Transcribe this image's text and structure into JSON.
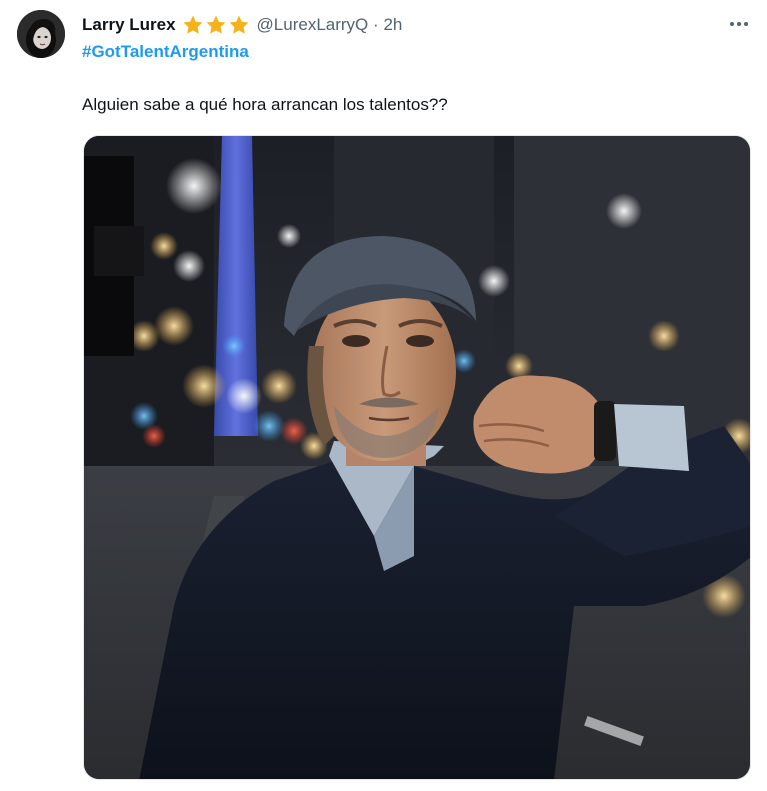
{
  "user": {
    "display_name": "Larry Lurex",
    "handle": "@LurexLarryQ",
    "separator": "·",
    "time": "2h",
    "badge_icon": "star-icon",
    "badge_count": 3,
    "badge_color": "#f4b31a"
  },
  "tweet": {
    "hashtag": "#GotTalentArgentina",
    "text": "Alguien sabe a qué hora arrancan los talentos??"
  },
  "icons": {
    "more": "more-horizontal-icon",
    "avatar": "avatar"
  },
  "colors": {
    "hashtag": "#1d9bf0",
    "secondary_text": "#536471",
    "primary_text": "#0f1419"
  }
}
